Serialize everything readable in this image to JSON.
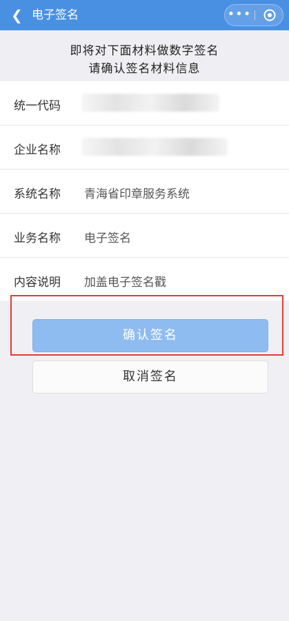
{
  "nav": {
    "back_icon": "chevron-left-icon",
    "title": "电子签名",
    "more_icon": "more-dots-icon",
    "close_icon": "target-close-icon",
    "bar_color": "#4a90e2"
  },
  "notice": {
    "line1": "即将对下面材料做数字签名",
    "line2": "请确认签名材料信息"
  },
  "fields": [
    {
      "label": "统一代码",
      "value": ""
    },
    {
      "label": "企业名称",
      "value": ""
    },
    {
      "label": "系统名称",
      "value": "青海省印章服务系统"
    },
    {
      "label": "业务名称",
      "value": "电子签名"
    },
    {
      "label": "内容说明",
      "value": "加盖电子签名戳"
    }
  ],
  "buttons": {
    "confirm_label": "确认签名",
    "cancel_label": "取消签名"
  },
  "colors": {
    "primary_button": "#8fbcf0",
    "highlight_border": "#e53935"
  }
}
